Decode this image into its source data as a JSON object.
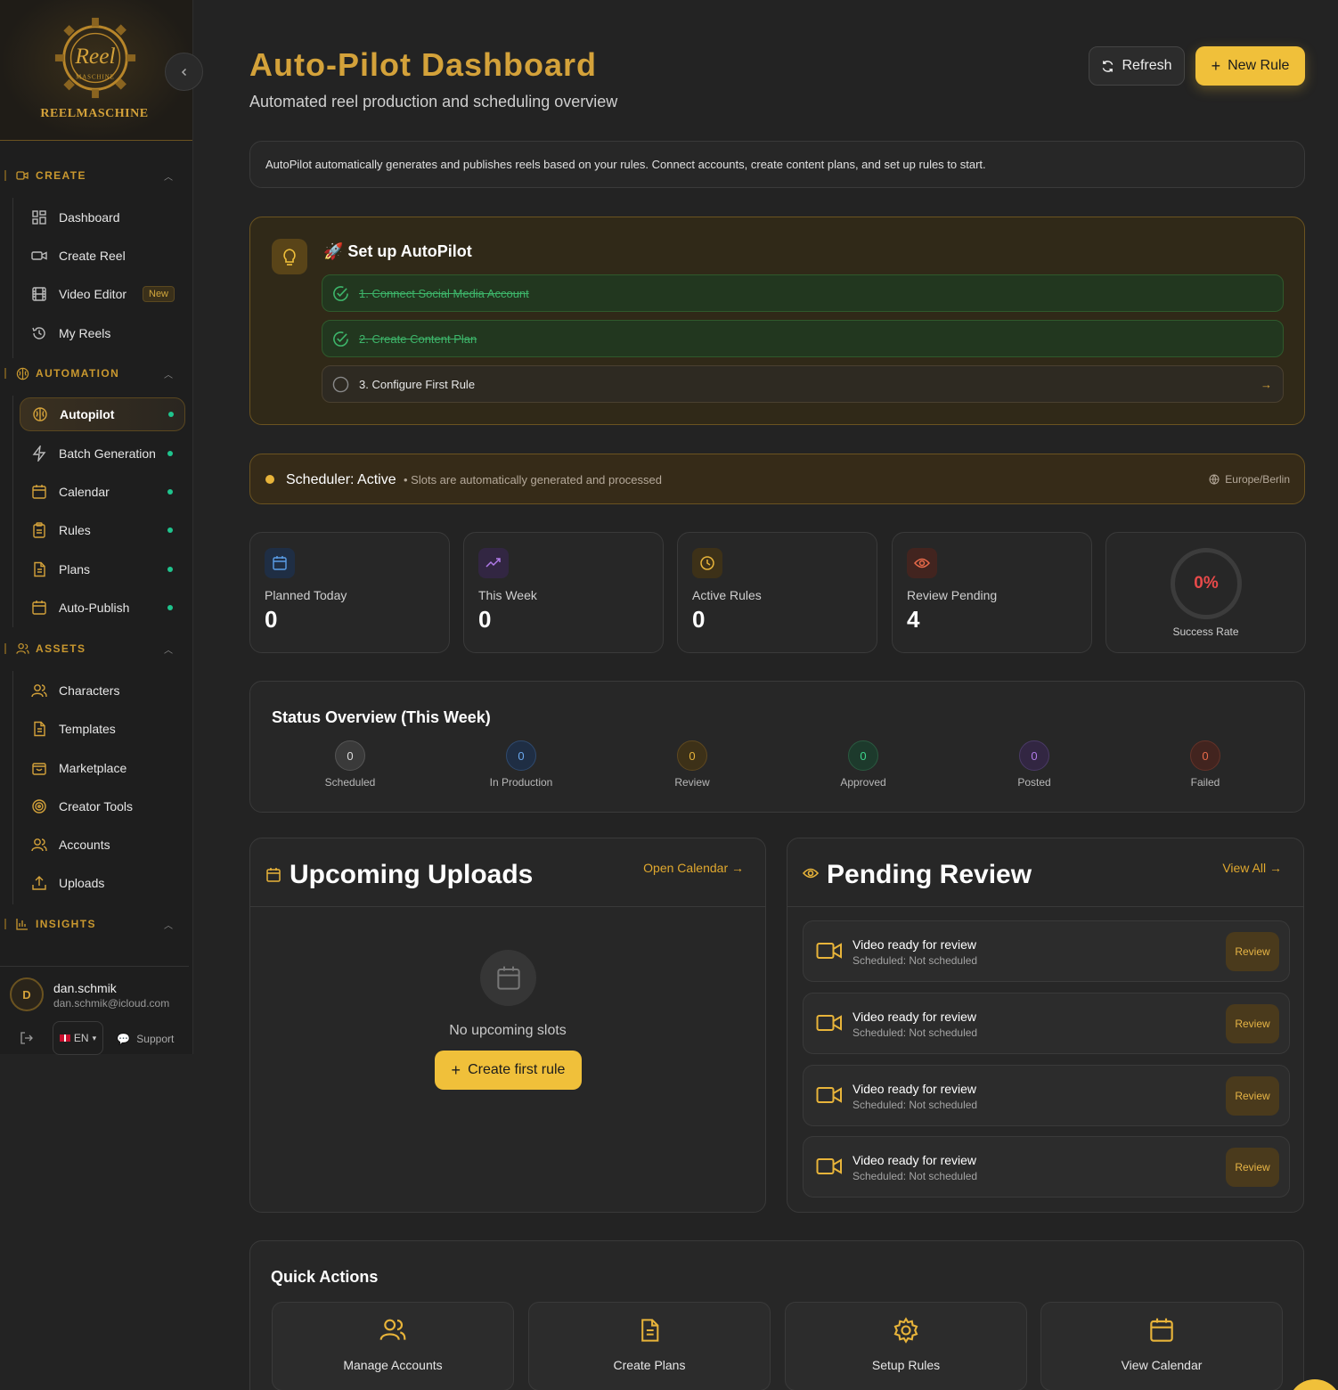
{
  "sidebar": {
    "brand_name": "REELMASCHINE",
    "logo_text": "Reel",
    "logo_subtext": "MASCHINE",
    "collapse_icon": "chevron-left-icon",
    "sections": {
      "create": "CREATE",
      "automation": "AUTOMATION",
      "assets": "ASSETS",
      "insights": "INSIGHTS"
    },
    "create_items": [
      "Dashboard",
      "Create Reel",
      "Video Editor",
      "My Reels"
    ],
    "new_badge": "New",
    "automation_items": [
      "Autopilot",
      "Batch Generation",
      "Calendar",
      "Rules",
      "Plans",
      "Auto-Publish"
    ],
    "asset_items": [
      "Characters",
      "Templates",
      "Marketplace",
      "Creator Tools",
      "Accounts",
      "Uploads"
    ],
    "user": {
      "initial": "D",
      "name": "dan.schmik",
      "email": "dan.schmik@icloud.com",
      "lang": "EN",
      "support": "Support"
    }
  },
  "header": {
    "title": "Auto-Pilot Dashboard",
    "subtitle": "Automated reel production and scheduling overview",
    "refresh_label": "Refresh",
    "new_rule_label": "New Rule"
  },
  "info": {
    "text": "AutoPilot automatically generates and publishes reels based on your rules. Connect accounts, create content plans, and set up rules to start."
  },
  "setup": {
    "title": "🚀 Set up AutoPilot",
    "steps": [
      {
        "label": "1. Connect Social Media Account",
        "done": true
      },
      {
        "label": "2. Create Content Plan",
        "done": true
      },
      {
        "label": "3. Configure First Rule",
        "done": false
      }
    ],
    "arrow": "→"
  },
  "scheduler": {
    "title": "Scheduler: Active",
    "subtitle": "• Slots are automatically generated and processed",
    "timezone": "Europe/Berlin"
  },
  "stats": [
    {
      "label": "Planned Today",
      "value": "0",
      "icon": "calendar-icon"
    },
    {
      "label": "This Week",
      "value": "0",
      "icon": "trending-up-icon"
    },
    {
      "label": "Active Rules",
      "value": "0",
      "icon": "clock-icon"
    },
    {
      "label": "Review Pending",
      "value": "4",
      "icon": "eye-icon"
    }
  ],
  "success_rate": {
    "value": "0%",
    "label": "Success Rate"
  },
  "status_overview": {
    "title": "Status Overview (This Week)",
    "items": [
      {
        "label": "Scheduled",
        "value": "0"
      },
      {
        "label": "In Production",
        "value": "0"
      },
      {
        "label": "Review",
        "value": "0"
      },
      {
        "label": "Approved",
        "value": "0"
      },
      {
        "label": "Posted",
        "value": "0"
      },
      {
        "label": "Failed",
        "value": "0"
      }
    ]
  },
  "upcoming": {
    "title": "Upcoming Uploads",
    "link": "Open Calendar →",
    "empty_text": "No upcoming slots",
    "button": "Create first rule"
  },
  "pending_review": {
    "title": "Pending Review",
    "link": "View All →",
    "items": [
      {
        "title": "Video ready for review",
        "subtitle": "Scheduled: Not scheduled",
        "button": "Review"
      },
      {
        "title": "Video ready for review",
        "subtitle": "Scheduled: Not scheduled",
        "button": "Review"
      },
      {
        "title": "Video ready for review",
        "subtitle": "Scheduled: Not scheduled",
        "button": "Review"
      },
      {
        "title": "Video ready for review",
        "subtitle": "Scheduled: Not scheduled",
        "button": "Review"
      }
    ]
  },
  "quick_actions": {
    "title": "Quick Actions",
    "items": [
      "Manage Accounts",
      "Create Plans",
      "Setup Rules",
      "View Calendar"
    ]
  },
  "colors": {
    "accent": "#f0c03a",
    "gold": "#d4a23a",
    "success": "#1fc48d",
    "danger": "#e84a4a"
  }
}
